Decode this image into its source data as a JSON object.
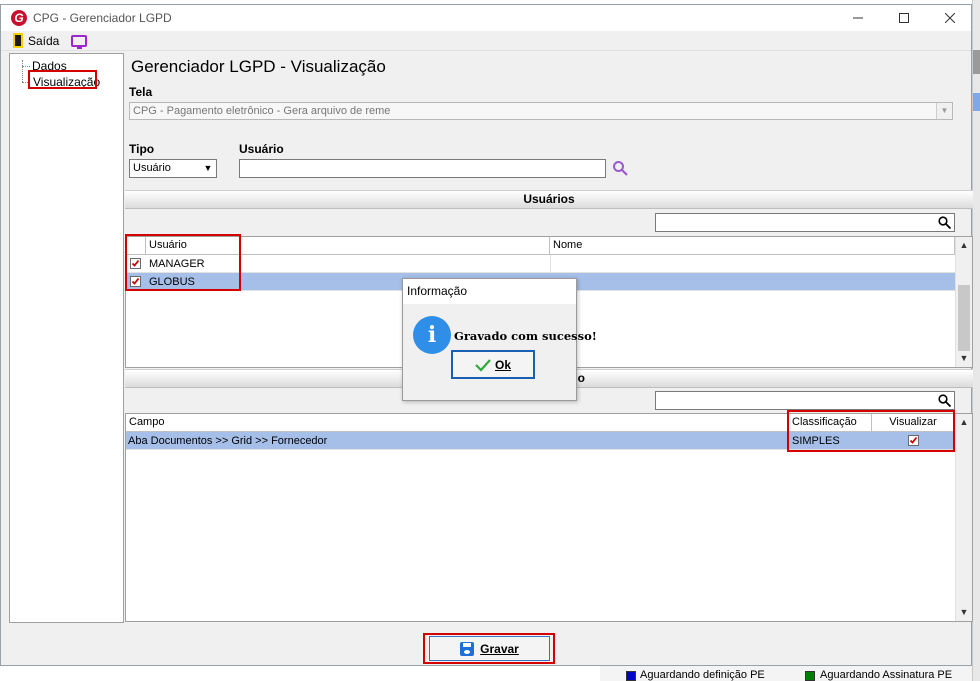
{
  "window": {
    "title": "CPG - Gerenciador LGPD",
    "logo_letter": "G"
  },
  "toolbar": {
    "exit_label": "Saída"
  },
  "tree": {
    "items": [
      {
        "label": "Dados"
      },
      {
        "label": "Visualização"
      }
    ]
  },
  "main": {
    "title": "Gerenciador LGPD - Visualização",
    "tela_label": "Tela",
    "tela_value": "CPG -  Pagamento eletrônico - Gera arquivo de reme",
    "tipo_label": "Tipo",
    "tipo_value": "Usuário",
    "usuario_label": "Usuário",
    "usuario_value": ""
  },
  "users_section": {
    "title": "Usuários",
    "columns": [
      "Usuário",
      "Nome"
    ],
    "rows": [
      {
        "usuario": "MANAGER",
        "nome": "",
        "checked": true,
        "selected": false
      },
      {
        "usuario": "GLOBUS",
        "nome": "",
        "checked": true,
        "selected": true
      }
    ]
  },
  "fields_section": {
    "title_partial": "o",
    "columns": [
      "Campo",
      "Classificação",
      "Visualizar"
    ],
    "rows": [
      {
        "campo": "Aba Documentos >> Grid >> Fornecedor",
        "classificacao": "SIMPLES",
        "visualizar": true
      }
    ]
  },
  "dialog": {
    "title": "Informação",
    "message": "Gravado com sucesso!",
    "ok_label": "Ok",
    "icon": "info-icon"
  },
  "footer": {
    "save_label": "Gravar"
  },
  "background": {
    "legend": [
      {
        "label": "Aguardando definição PE",
        "color": "#0000cc"
      },
      {
        "label": "Aguardando Assinatura PE",
        "color": "#008000"
      }
    ]
  },
  "colors": {
    "highlight": "#d40000",
    "selection": "#a6bfe8",
    "info_blue": "#2f8ee8"
  }
}
